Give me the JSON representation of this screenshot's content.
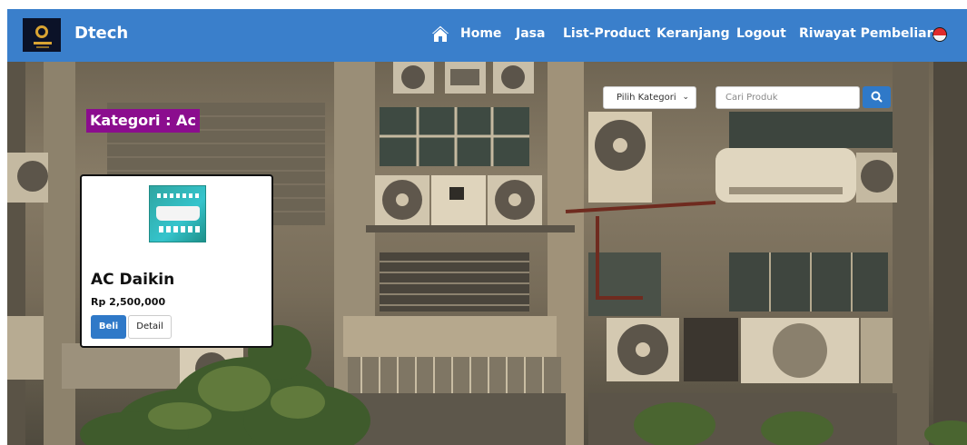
{
  "navbar": {
    "brand_name": "Dtech",
    "brand_color": "#3a7fcb",
    "home_icon": "home-icon",
    "items": [
      {
        "label": "Home"
      },
      {
        "label": "Jasa"
      },
      {
        "label": "List-Product"
      },
      {
        "label": "Keranjang"
      },
      {
        "label": "Logout"
      },
      {
        "label": "Riwayat Pembelian"
      }
    ],
    "flag_icon": "indonesia-flag-icon"
  },
  "filter": {
    "category_selected": "Pilih Kategori",
    "search_placeholder": "Cari Produk",
    "search_icon": "search-icon"
  },
  "category_heading": "Kategori : Ac",
  "products": [
    {
      "name": "AC Daikin",
      "price": "Rp 2,500,000",
      "buy_label": "Beli",
      "detail_label": "Detail"
    }
  ],
  "colors": {
    "accent": "#2f79c8",
    "category_badge": "#8b0d8e"
  }
}
